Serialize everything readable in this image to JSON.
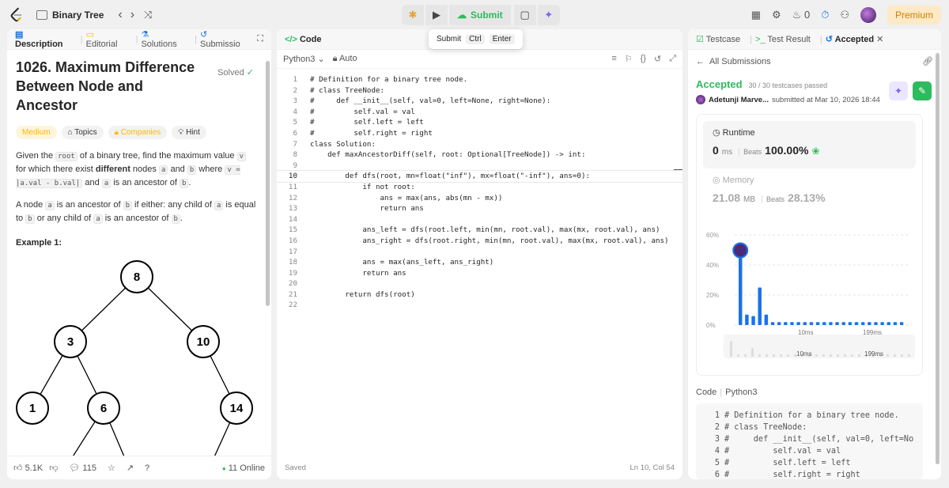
{
  "topbar": {
    "problem_list_label": "Binary Tree",
    "submit_label": "Submit",
    "tooltip": {
      "label": "Submit",
      "key1": "Ctrl",
      "key2": "Enter"
    },
    "streak_count": "0",
    "premium_label": "Premium"
  },
  "left_panel": {
    "tabs": [
      "Description",
      "Editorial",
      "Solutions",
      "Submissio"
    ],
    "title": "1026. Maximum Difference Between Node and Ancestor",
    "solved_label": "Solved",
    "chips": {
      "difficulty": "Medium",
      "topics": "Topics",
      "companies": "Companies",
      "hint": "Hint"
    },
    "desc_p1_parts": [
      "Given the ",
      "root",
      " of a binary tree, find the maximum value ",
      "v",
      " for which there exist ",
      "different",
      " nodes ",
      "a",
      " and ",
      "b",
      " where ",
      "v = |a.val - b.val|",
      " and ",
      "a",
      " is an ancestor of ",
      "b",
      "."
    ],
    "desc_p2_parts": [
      "A node ",
      "a",
      " is an ancestor of ",
      "b",
      " if either: any child of ",
      "a",
      " is equal to ",
      "b",
      " or any child of ",
      "a",
      " is an ancestor of ",
      "b",
      "."
    ],
    "example_label": "Example 1:",
    "tree_nodes": [
      "8",
      "3",
      "10",
      "1",
      "6",
      "14"
    ],
    "footer": {
      "likes": "5.1K",
      "comments": "115",
      "online": "11 Online"
    }
  },
  "code_panel": {
    "tab_label": "Code",
    "language": "Python3",
    "mode": "Auto",
    "lines": [
      "# Definition for a binary tree node.",
      "# class TreeNode:",
      "#     def __init__(self, val=0, left=None, right=None):",
      "#         self.val = val",
      "#         self.left = left",
      "#         self.right = right",
      "class Solution:",
      "    def maxAncestorDiff(self, root: Optional[TreeNode]) -> int:",
      "",
      "        def dfs(root, mn=float(\"inf\"), mx=float(\"-inf\"), ans=0):",
      "            if not root:",
      "                ans = max(ans, abs(mn - mx))",
      "                return ans",
      "",
      "            ans_left = dfs(root.left, min(mn, root.val), max(mx, root.val), ans)",
      "            ans_right = dfs(root.right, min(mn, root.val), max(mx, root.val), ans)",
      "",
      "            ans = max(ans_left, ans_right)",
      "            return ans",
      "",
      "        return dfs(root)",
      ""
    ],
    "current_line": 10,
    "status": "Saved",
    "cursor": "Ln 10, Col 54"
  },
  "right_panel": {
    "tabs": [
      "Testcase",
      "Test Result",
      "Accepted"
    ],
    "all_submissions": "All Submissions",
    "status": "Accepted",
    "testcases": "30 / 30 testcases passed",
    "user": "Adetunji Marve...",
    "submitted_at": "submitted at Mar 10, 2026 18:44",
    "runtime": {
      "label": "Runtime",
      "value": "0",
      "unit": "ms",
      "beats_label": "Beats",
      "beats": "100.00%"
    },
    "memory": {
      "label": "Memory",
      "value": "21.08",
      "unit": "MB",
      "beats_label": "Beats",
      "beats": "28.13%"
    },
    "code_label": "Code",
    "code_lang": "Python3",
    "code_lines": [
      "# Definition for a binary tree node.",
      "# class TreeNode:",
      "#     def __init__(self, val=0, left=No",
      "#         self.val = val",
      "#         self.left = left",
      "#         self.right = right"
    ]
  },
  "chart_data": {
    "type": "bar",
    "y_ticks": [
      "60%",
      "40%",
      "20%",
      "0%"
    ],
    "x_ticks": [
      "10ms",
      "199ms"
    ],
    "ylim": [
      0,
      60
    ],
    "values": [
      45,
      7,
      6,
      25,
      7,
      2,
      2,
      2,
      2,
      2,
      2,
      2,
      2,
      2,
      2,
      2,
      2,
      2,
      2,
      2,
      2,
      2,
      2,
      2,
      2,
      2
    ],
    "highlight_index": 0,
    "colors": {
      "bar": "#1a73e8",
      "grid": "#e5e5e5"
    }
  }
}
